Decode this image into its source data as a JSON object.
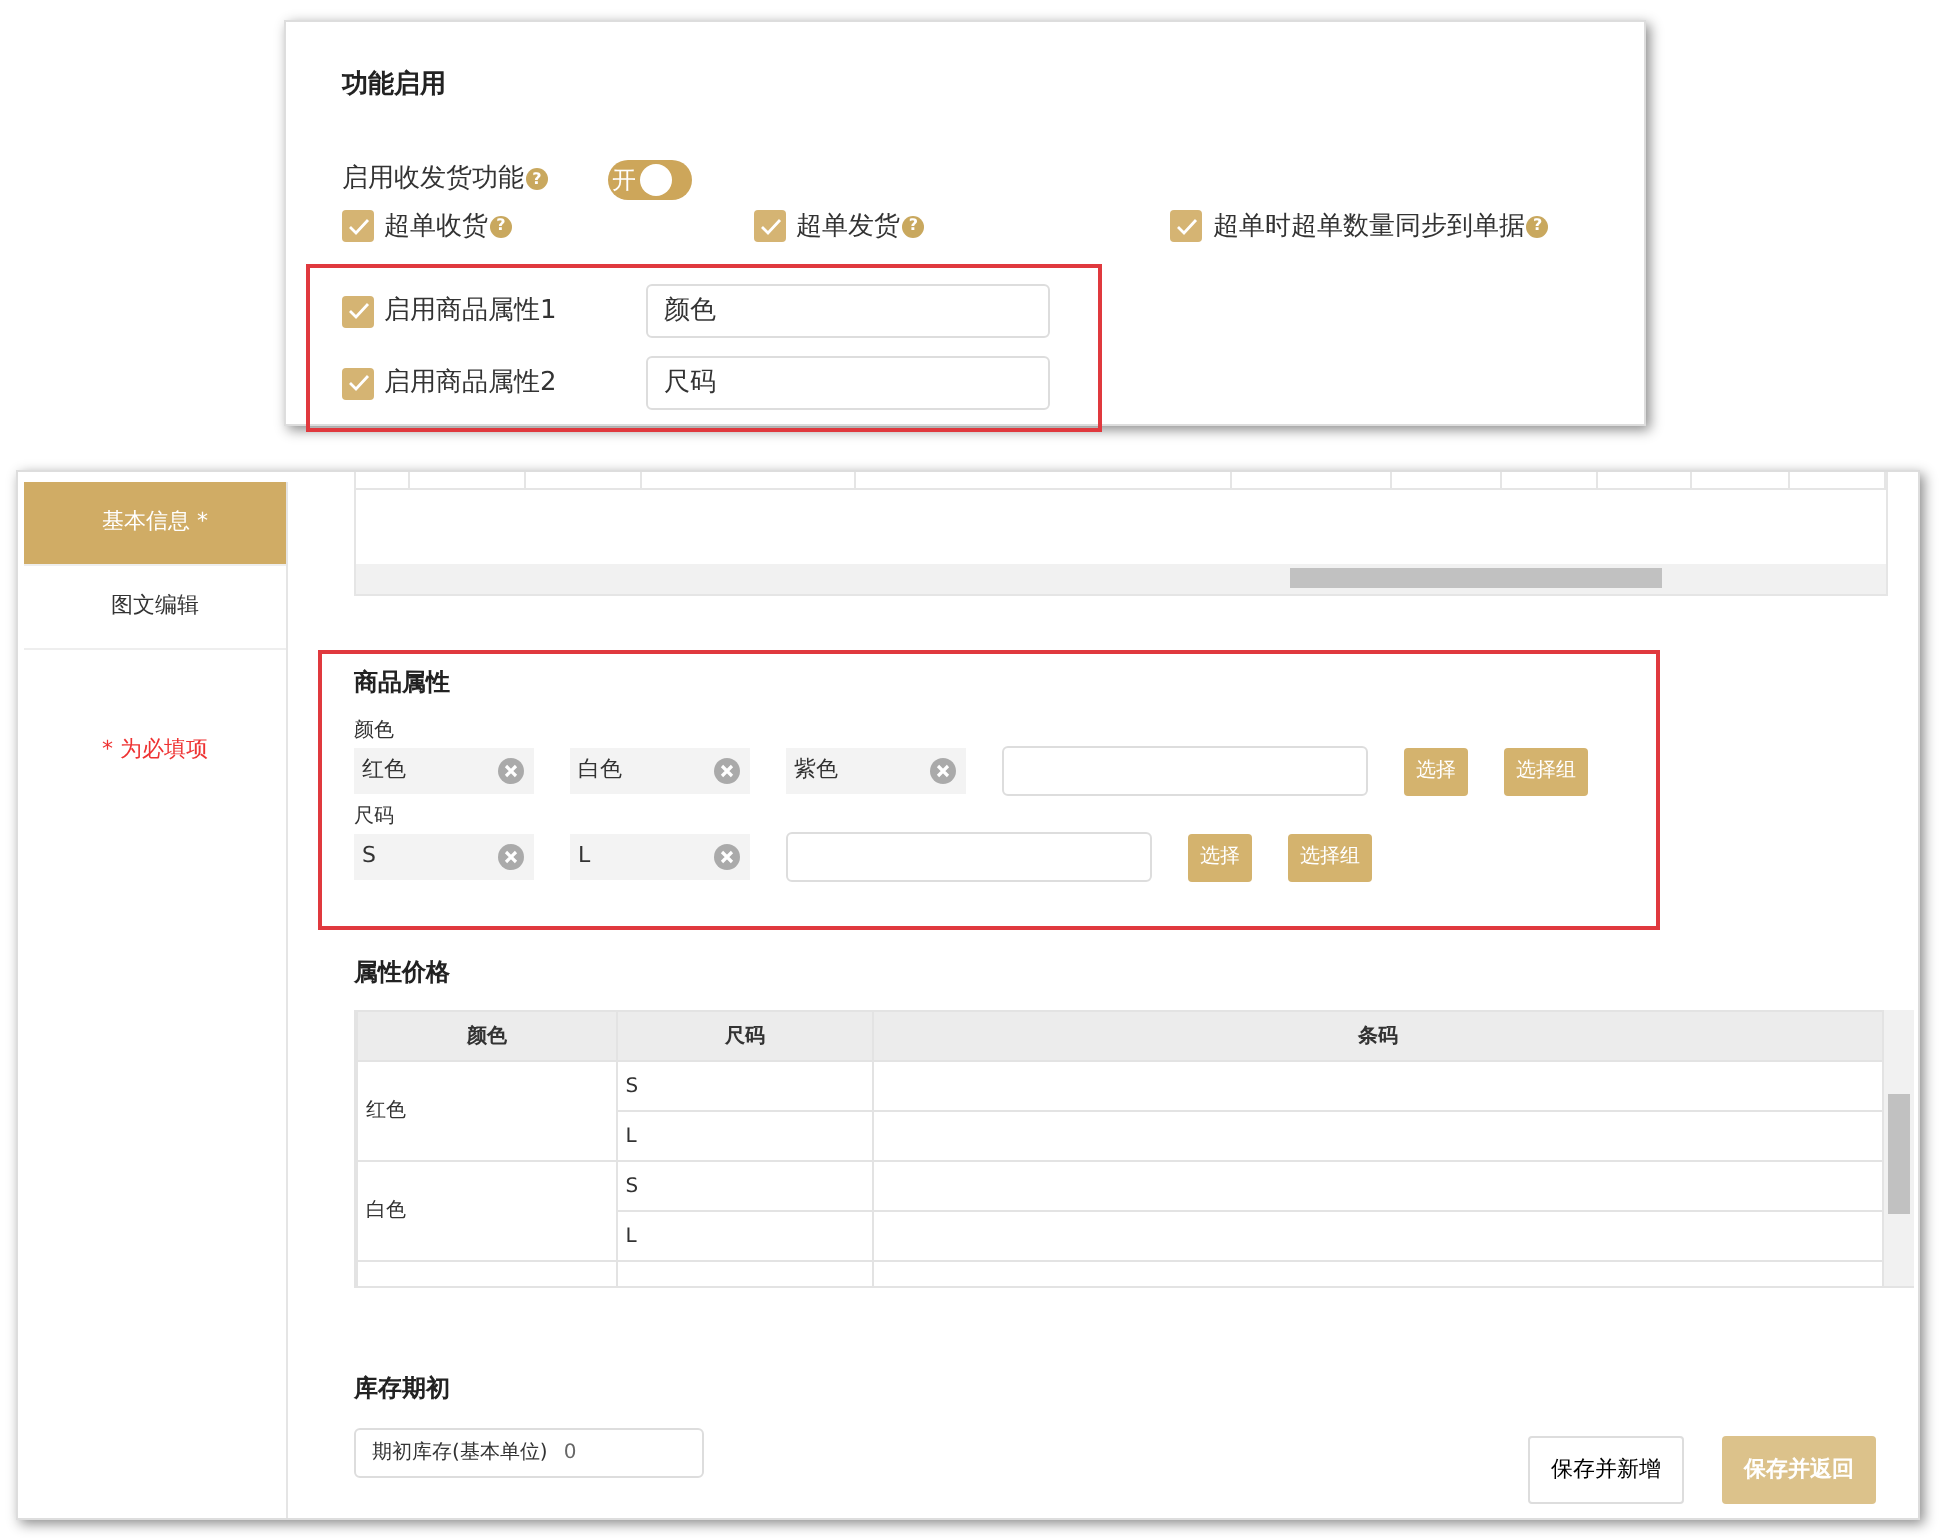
{
  "settings_panel": {
    "title": "功能启用",
    "toggle": {
      "label": "启用收发货功能",
      "help": "?",
      "on": true,
      "text": "开"
    },
    "options": [
      {
        "label": "超单收货",
        "help": "?",
        "checked": true
      },
      {
        "label": "超单发货",
        "help": "?",
        "checked": true
      },
      {
        "label": "超单时超单数量同步到单据",
        "help": "?",
        "checked": true
      }
    ],
    "attributes": [
      {
        "label": "启用商品属性1",
        "checked": true,
        "value": "颜色"
      },
      {
        "label": "启用商品属性2",
        "checked": true,
        "value": "尺码"
      }
    ]
  },
  "form": {
    "sidebar": {
      "items": [
        {
          "label": "基本信息 *",
          "selected": true
        },
        {
          "label": "图文编辑",
          "selected": false
        }
      ],
      "required_note": "* 为必填项"
    },
    "product_attributes": {
      "title": "商品属性",
      "groups": [
        {
          "name": "颜色",
          "values": [
            "红色",
            "白色",
            "紫色"
          ],
          "buttons": [
            "选择",
            "选择组"
          ]
        },
        {
          "name": "尺码",
          "values": [
            "S",
            "L"
          ],
          "buttons": [
            "选择",
            "选择组"
          ]
        }
      ]
    },
    "attribute_prices": {
      "title": "属性价格",
      "columns": [
        "颜色",
        "尺码",
        "条码"
      ],
      "rows": [
        {
          "value": "红色",
          "sizes": [
            "S",
            "L"
          ]
        },
        {
          "value": "白色",
          "sizes": [
            "S",
            "L"
          ]
        }
      ]
    },
    "stock": {
      "title": "库存期初",
      "field_label": "期初库存(基本单位)",
      "field_value": "0"
    },
    "buttons": [
      {
        "label": "保存并新增",
        "kind": "secondary"
      },
      {
        "label": "保存并返回",
        "kind": "primary"
      }
    ]
  }
}
